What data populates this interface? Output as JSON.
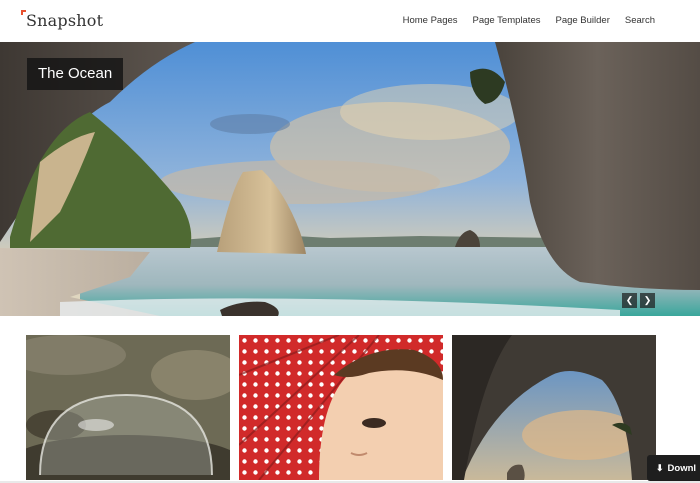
{
  "header": {
    "logo": "Snapshot",
    "nav": [
      "Home Pages",
      "Page Templates",
      "Page Builder",
      "Search"
    ]
  },
  "hero": {
    "title": "The Ocean",
    "prev_icon": "chevron-left-icon",
    "next_icon": "chevron-right-icon"
  },
  "thumbnails": [
    {
      "subject": "water droplet bubble"
    },
    {
      "subject": "girl under red polka-dot umbrella"
    },
    {
      "subject": "sea cave arch"
    }
  ],
  "download": {
    "label": "Downl",
    "icon": "download-icon"
  },
  "colors": {
    "accent": "#e8502f",
    "text": "#333333",
    "overlay": "#141414"
  }
}
